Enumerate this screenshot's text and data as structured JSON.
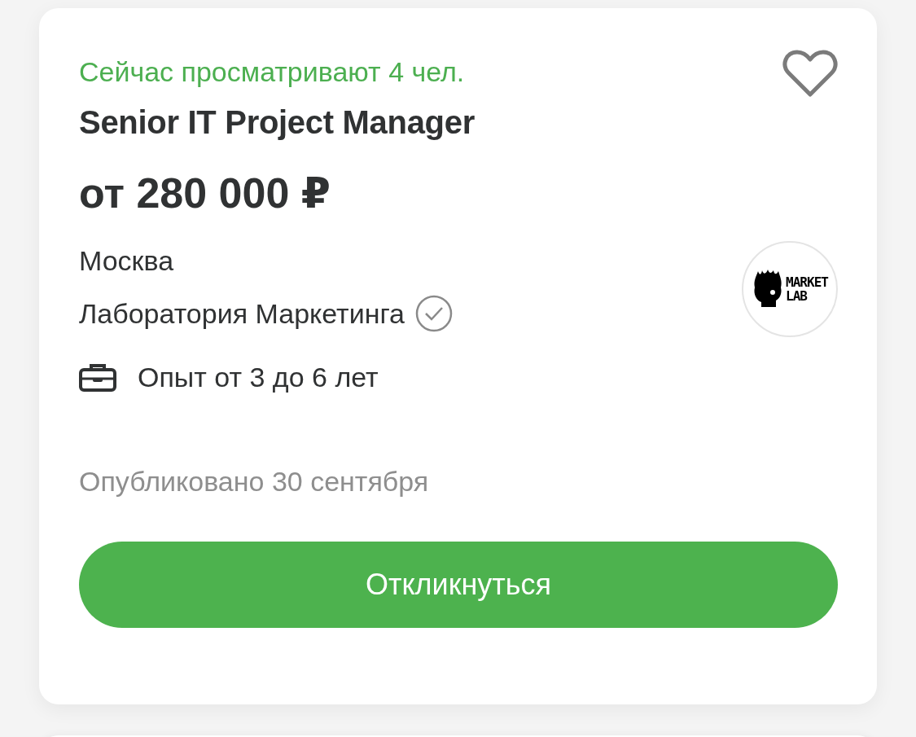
{
  "vacancy": {
    "viewers": "Сейчас просматривают 4 чел.",
    "favorite": false,
    "title": "Senior IT Project Manager",
    "salary": "от 280 000 ₽",
    "location": "Москва",
    "company": {
      "name": "Лаборатория Маркетинга",
      "verified": true
    },
    "logo": {
      "lines": [
        "MARKET",
        "LAB"
      ]
    },
    "experience": "Опыт от 3 до 6 лет",
    "published": "Опубликовано 30 сентября",
    "apply_button": "Откликнуться"
  }
}
